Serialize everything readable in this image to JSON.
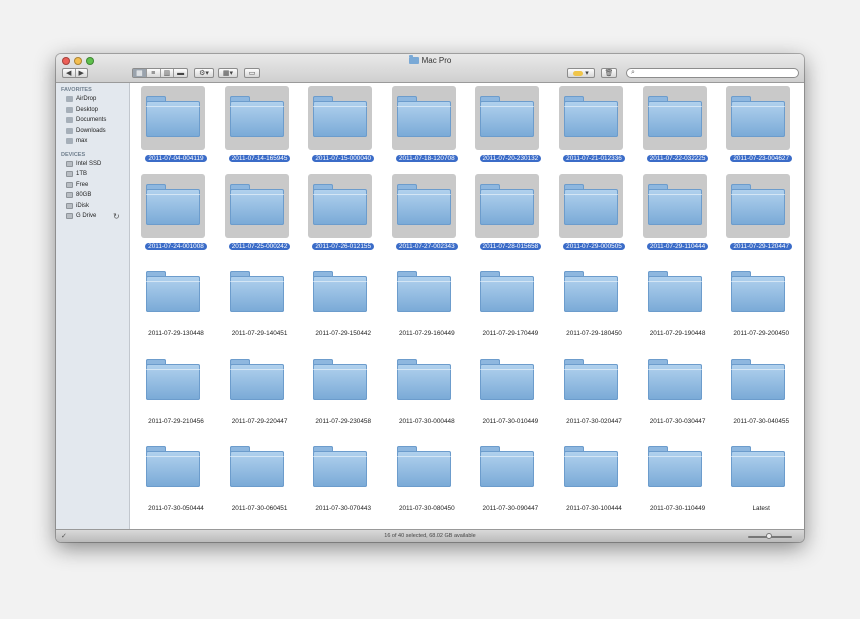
{
  "window": {
    "title": "Mac Pro",
    "search_placeholder": "",
    "colors": {
      "selection": "#3b6cc8",
      "folder": "#8fb8e0"
    }
  },
  "toolbar": {
    "back_icon": "chevron-left-icon",
    "forward_icon": "chevron-right-icon",
    "view_modes": [
      "icon-view-icon",
      "list-view-icon",
      "column-view-icon",
      "coverflow-view-icon"
    ],
    "active_view": "icon-view-icon",
    "action_icon": "gear-icon",
    "arrange_icon": "grid-icon",
    "share_icon": "screen-icon",
    "label_icon": "tag-icon",
    "trash_icon": "trash-icon",
    "search_icon": "search-icon"
  },
  "sidebar": {
    "favorites_header": "FAVORITES",
    "favorites": [
      "AirDrop",
      "Desktop",
      "Documents",
      "Downloads",
      "max"
    ],
    "devices_header": "DEVICES",
    "devices": [
      "Intel SSD",
      "1TB",
      "Free",
      "80GB",
      "iDisk",
      "G Drive"
    ]
  },
  "items": [
    {
      "name": "2011-07-04-004119",
      "selected": true
    },
    {
      "name": "2011-07-14-165945",
      "selected": true
    },
    {
      "name": "2011-07-15-000040",
      "selected": true
    },
    {
      "name": "2011-07-18-120708",
      "selected": true
    },
    {
      "name": "2011-07-20-230132",
      "selected": true
    },
    {
      "name": "2011-07-21-012336",
      "selected": true
    },
    {
      "name": "2011-07-22-032225",
      "selected": true
    },
    {
      "name": "2011-07-23-004627",
      "selected": true
    },
    {
      "name": "2011-07-24-001008",
      "selected": true
    },
    {
      "name": "2011-07-25-000242",
      "selected": true
    },
    {
      "name": "2011-07-26-012155",
      "selected": true
    },
    {
      "name": "2011-07-27-002343",
      "selected": true
    },
    {
      "name": "2011-07-28-015658",
      "selected": true
    },
    {
      "name": "2011-07-29-000505",
      "selected": true
    },
    {
      "name": "2011-07-29-110444",
      "selected": true
    },
    {
      "name": "2011-07-29-120447",
      "selected": true
    },
    {
      "name": "2011-07-29-130448",
      "selected": false
    },
    {
      "name": "2011-07-29-140451",
      "selected": false
    },
    {
      "name": "2011-07-29-150442",
      "selected": false
    },
    {
      "name": "2011-07-29-160449",
      "selected": false
    },
    {
      "name": "2011-07-29-170449",
      "selected": false
    },
    {
      "name": "2011-07-29-180450",
      "selected": false
    },
    {
      "name": "2011-07-29-190448",
      "selected": false
    },
    {
      "name": "2011-07-29-200450",
      "selected": false
    },
    {
      "name": "2011-07-29-210456",
      "selected": false
    },
    {
      "name": "2011-07-29-220447",
      "selected": false
    },
    {
      "name": "2011-07-29-230458",
      "selected": false
    },
    {
      "name": "2011-07-30-000448",
      "selected": false
    },
    {
      "name": "2011-07-30-010449",
      "selected": false
    },
    {
      "name": "2011-07-30-020447",
      "selected": false
    },
    {
      "name": "2011-07-30-030447",
      "selected": false
    },
    {
      "name": "2011-07-30-040455",
      "selected": false
    },
    {
      "name": "2011-07-30-050444",
      "selected": false
    },
    {
      "name": "2011-07-30-060451",
      "selected": false
    },
    {
      "name": "2011-07-30-070443",
      "selected": false
    },
    {
      "name": "2011-07-30-080450",
      "selected": false
    },
    {
      "name": "2011-07-30-090447",
      "selected": false
    },
    {
      "name": "2011-07-30-100444",
      "selected": false
    },
    {
      "name": "2011-07-30-110449",
      "selected": false
    },
    {
      "name": "Latest",
      "selected": false
    }
  ],
  "status": {
    "text": "16 of 40 selected, 68.02 GB available"
  }
}
